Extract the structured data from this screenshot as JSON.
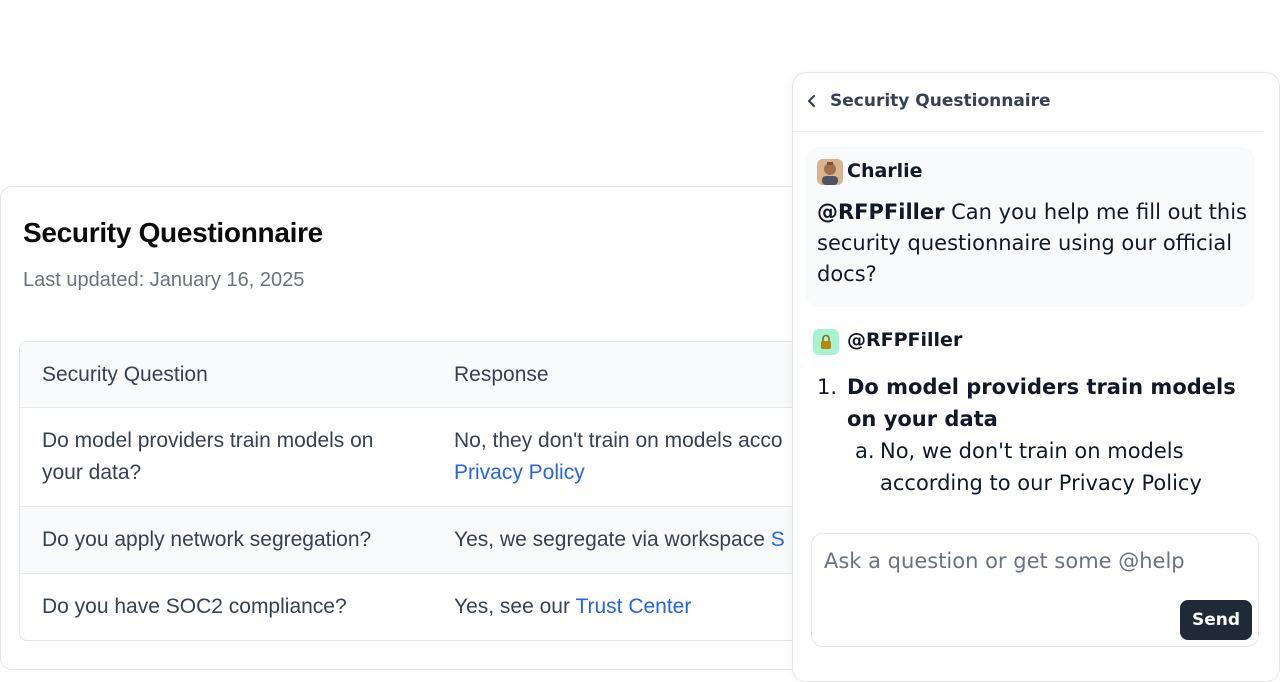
{
  "document": {
    "title": "Security Questionnaire",
    "last_updated": "Last updated: January 16, 2025",
    "table": {
      "headers": [
        "Security Question",
        "Response"
      ],
      "rows": [
        {
          "question": "Do model providers train models on your data?",
          "response_text": "No, they don't train on models acco",
          "response_link": "Privacy Policy"
        },
        {
          "question": "Do you apply network segregation?",
          "response_text": "Yes, we segregate via workspace ",
          "response_link": "S"
        },
        {
          "question": "Do you have SOC2 compliance?",
          "response_text": "Yes, see our ",
          "response_link": "Trust Center"
        }
      ]
    }
  },
  "chat": {
    "title": "Security Questionnaire",
    "user_message": {
      "sender": "Charlie",
      "mention": "@RFPFiller",
      "text": " Can you help me fill out this security questionnaire using our official docs?"
    },
    "bot_message": {
      "sender": "@RFPFiller",
      "item_number": "1.",
      "item_text": "Do model providers train models on your data",
      "sub_number": "a.",
      "sub_text": "No, we don't train on models according to our Privacy Policy"
    },
    "input": {
      "placeholder": "Ask a question or get some @help",
      "value": ""
    },
    "send_label": "Send"
  },
  "colors": {
    "link": "#2563eb",
    "send_button": "#1f2937",
    "bot_avatar": "#a7f3d0"
  }
}
